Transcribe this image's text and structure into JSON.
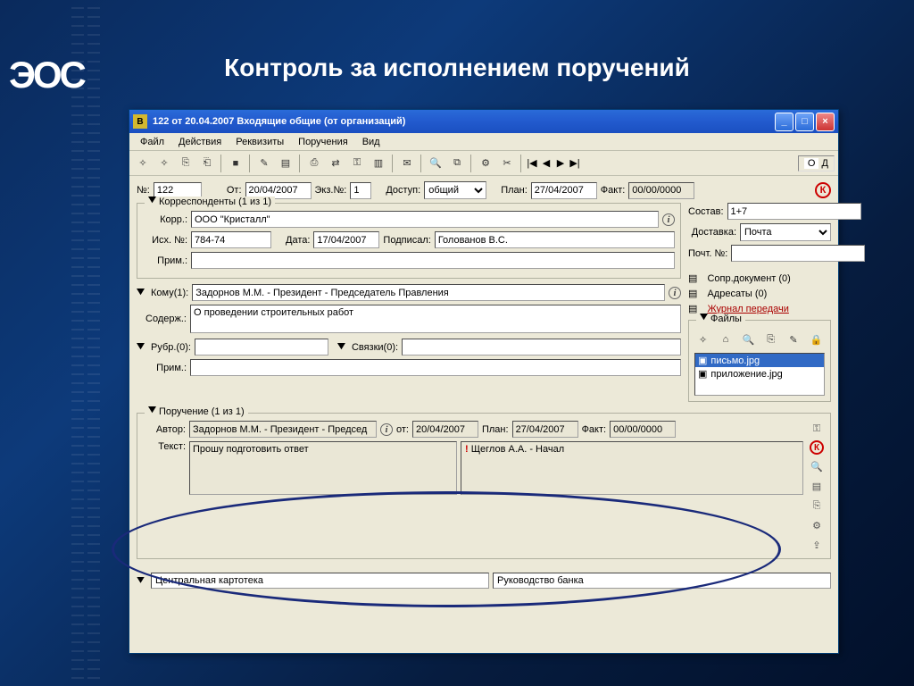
{
  "slide": {
    "title": "Контроль за исполнением поручений",
    "logo": "ЭОС"
  },
  "window": {
    "title": "122 от 20.04.2007 Входящие общие (от организаций)"
  },
  "menu": {
    "file": "Файл",
    "actions": "Действия",
    "props": "Реквизиты",
    "orders": "Поручения",
    "view": "Вид"
  },
  "od": {
    "o": "О",
    "d": "Д"
  },
  "header": {
    "num_lbl": "№:",
    "num": "122",
    "from_lbl": "От:",
    "from": "20/04/2007",
    "ex_lbl": "Экз.№:",
    "ex": "1",
    "access_lbl": "Доступ:",
    "access": "общий",
    "plan_lbl": "План:",
    "plan": "27/04/2007",
    "fact_lbl": "Факт:",
    "fact": "00/00/0000"
  },
  "korr": {
    "legend": "Корреспонденты (1 из 1)",
    "korr_lbl": "Корр.:",
    "korr": "ООО \"Кристалл\"",
    "out_lbl": "Исх. №:",
    "out": "784-74",
    "date_lbl": "Дата:",
    "date": "17/04/2007",
    "signed_lbl": "Подписал:",
    "signed": "Голованов В.С.",
    "note_lbl": "Прим.:",
    "note": ""
  },
  "compose": {
    "sostav_lbl": "Состав:",
    "sostav": "1+7",
    "delivery_lbl": "Доставка:",
    "delivery": "Почта",
    "postnum_lbl": "Почт. №:",
    "postnum": ""
  },
  "komu": {
    "legend": "Кому(1):",
    "value": "Задорнов М.М. - Президент - Председатель Правления",
    "sod_lbl": "Содерж.:",
    "sod": "О проведении строительных работ"
  },
  "links": {
    "sopr": "Сопр.документ (0)",
    "adr": "Адресаты (0)",
    "journal": "Журнал передачи"
  },
  "rubr": {
    "legend": "Рубр.(0):",
    "sv_lbl": "Связки(0):",
    "note_lbl": "Прим.:",
    "note": ""
  },
  "files": {
    "legend": "Файлы",
    "items": [
      "письмо.jpg",
      "приложение.jpg"
    ]
  },
  "order": {
    "legend": "Поручение (1 из 1)",
    "author_lbl": "Автор:",
    "author": "Задорнов М.М. - Президент - Председ",
    "from_lbl": "от:",
    "from": "20/04/2007",
    "plan_lbl": "План:",
    "plan": "27/04/2007",
    "fact_lbl": "Факт:",
    "fact": "00/00/0000",
    "text_lbl": "Текст:",
    "text": "Прошу подготовить ответ",
    "exec_marker": "!",
    "exec": "Щеглов А.А. - Начал"
  },
  "footer": {
    "left": "Центральная картотека",
    "right": "Руководство банка"
  }
}
